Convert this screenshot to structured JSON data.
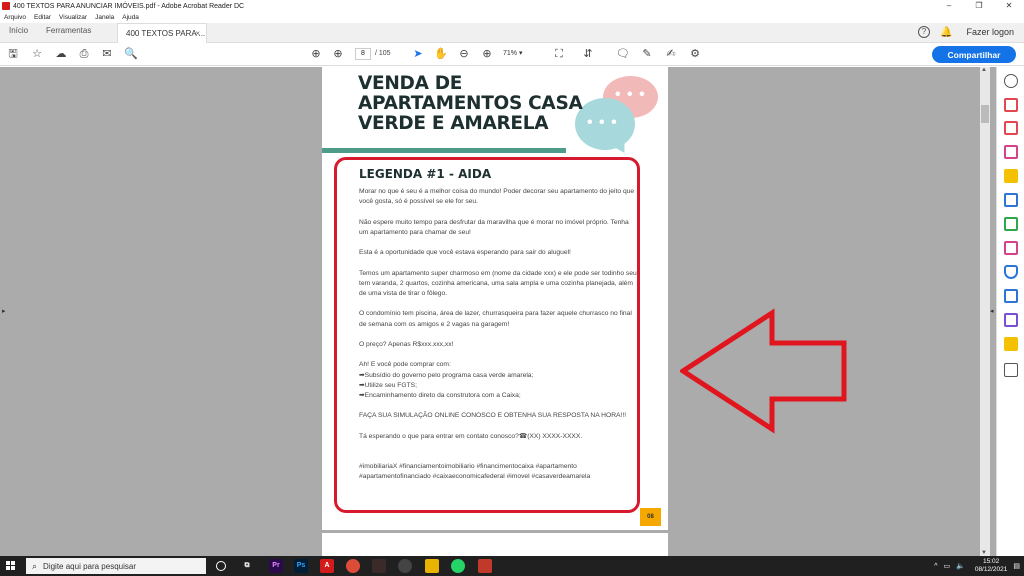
{
  "window": {
    "title": "400 TEXTOS PARA ANUNCIAR IMÓVEIS.pdf - Adobe Acrobat Reader DC",
    "controls": [
      "–",
      "❐",
      "✕"
    ]
  },
  "menu": [
    "Arquivo",
    "Editar",
    "Visualizar",
    "Janela",
    "Ajuda"
  ],
  "tabs": {
    "home": "Início",
    "tools": "Ferramentas",
    "document": "400 TEXTOS PARA ...",
    "close": "×",
    "login": "Fazer logon"
  },
  "toolbar": {
    "page_current": "8",
    "page_total": "/ 105",
    "zoom": "71%",
    "share": "Compartilhar"
  },
  "page": {
    "heading": "VENDA DE APARTAMENTOS CASA VERDE E AMARELA",
    "legend_title": "LEGENDA #1 - AIDA",
    "paragraphs": [
      "Morar no que é seu é a melhor coisa do mundo! Poder decorar seu apartamento do jeito que você gosta, só é possível se ele for seu.",
      "Não espere muito tempo para desfrutar da maravilha que é morar no imóvel próprio. Tenha um apartamento para chamar de seu!",
      "Esta é a oportunidade que você estava esperando para sair do aluguel!",
      "Temos um apartamento super charmoso em (nome da cidade xxx) e ele pode ser todinho seu: tem varanda, 2 quartos, cozinha americana, uma sala ampla e uma cozinha planejada, além de uma vista de tirar o fôlego.",
      "O condomínio tem piscina, área de lazer, churrasqueira para fazer aquele churrasco no final de semana com os amigos e 2 vagas na garagem!",
      "O preço? Apenas R$xxx.xxx,xx!"
    ],
    "buy_intro": "Ah! E você pode comprar com:",
    "buy_items": [
      "➡Subsídio do governo pelo programa casa verde amarela;",
      "➡Utilize seu FGTS;",
      "➡Encaminhamento direto da construtora com a Caixa;"
    ],
    "cta": "FAÇA SUA SIMULAÇÃO ONLINE CONOSCO E OBTENHA SUA RESPOSTA NA HORA!!!",
    "contact": "Tá esperando o que para entrar em contato conosco?☎(XX) XXXX-XXXX.",
    "hashtags": "#imobiliariaX #financiamentoimobiliario #financimentocaixa #apartamento #apartamentofinanciado #caixaeconomicafederal #imovel #casaverdeamarela",
    "page_number": "08"
  },
  "taskbar": {
    "search_placeholder": "Digite aqui para pesquisar",
    "time": "15:02",
    "date": "08/12/2021"
  },
  "colors": {
    "accent_blue": "#1473e6",
    "highlight_red": "#d7192d",
    "teal": "#4e9b89",
    "page_badge": "#f5a800"
  }
}
